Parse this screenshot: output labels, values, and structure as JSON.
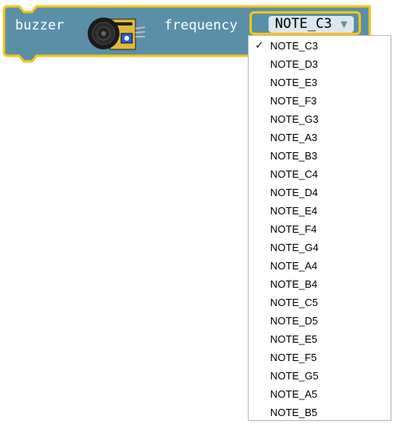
{
  "block": {
    "label_buzzer": "buzzer",
    "label_frequency": "frequency",
    "icon": "buzzer-module-icon",
    "colors": {
      "block_fill": "#5b8fa8",
      "block_border": "#f5c518",
      "field_bg": "#dbe7ec"
    }
  },
  "field": {
    "value": "NOTE_C3",
    "arrow": "▼"
  },
  "menu": {
    "check_mark": "✓",
    "selected_index": 0,
    "items": [
      "NOTE_C3",
      "NOTE_D3",
      "NOTE_E3",
      "NOTE_F3",
      "NOTE_G3",
      "NOTE_A3",
      "NOTE_B3",
      "NOTE_C4",
      "NOTE_D4",
      "NOTE_E4",
      "NOTE_F4",
      "NOTE_G4",
      "NOTE_A4",
      "NOTE_B4",
      "NOTE_C5",
      "NOTE_D5",
      "NOTE_E5",
      "NOTE_F5",
      "NOTE_G5",
      "NOTE_A5",
      "NOTE_B5"
    ]
  }
}
